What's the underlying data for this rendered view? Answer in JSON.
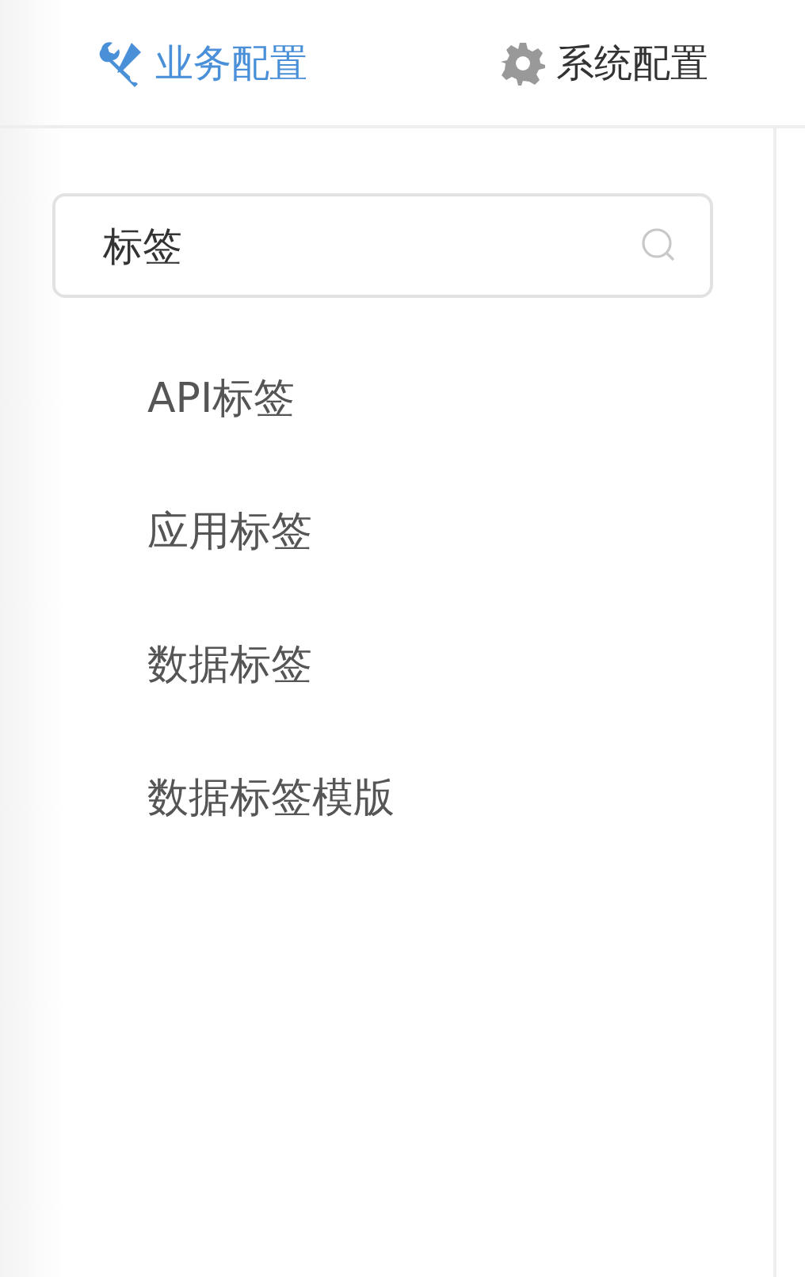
{
  "tabs": [
    {
      "label": "业务配置",
      "selected": true
    },
    {
      "label": "系统配置",
      "selected": false
    }
  ],
  "search": {
    "value": "标签"
  },
  "menu": [
    {
      "label": "API标签"
    },
    {
      "label": "应用标签"
    },
    {
      "label": "数据标签"
    },
    {
      "label": "数据标签模版"
    }
  ]
}
